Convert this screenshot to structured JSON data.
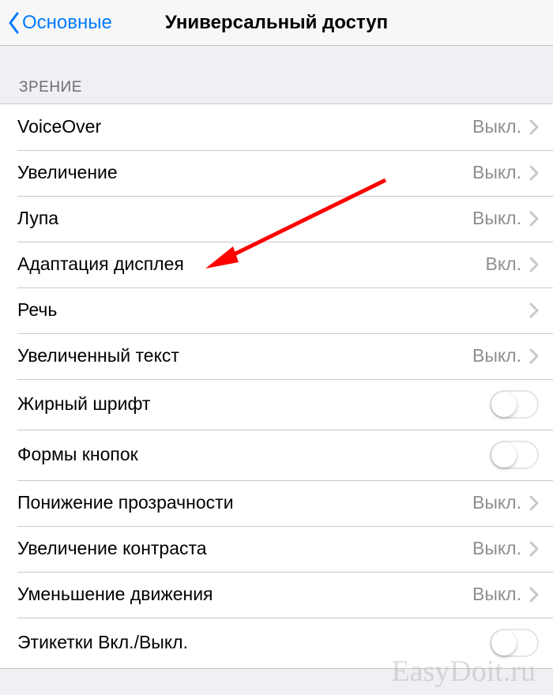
{
  "nav": {
    "back_label": "Основные",
    "title": "Универсальный доступ"
  },
  "section": {
    "header": "ЗРЕНИЕ"
  },
  "items": [
    {
      "label": "VoiceOver",
      "value": "Выкл.",
      "kind": "disclosure"
    },
    {
      "label": "Увеличение",
      "value": "Выкл.",
      "kind": "disclosure"
    },
    {
      "label": "Лупа",
      "value": "Выкл.",
      "kind": "disclosure"
    },
    {
      "label": "Адаптация дисплея",
      "value": "Вкл.",
      "kind": "disclosure"
    },
    {
      "label": "Речь",
      "value": "",
      "kind": "disclosure"
    },
    {
      "label": "Увеличенный текст",
      "value": "Выкл.",
      "kind": "disclosure"
    },
    {
      "label": "Жирный шрифт",
      "value": "",
      "kind": "toggle",
      "on": false
    },
    {
      "label": "Формы кнопок",
      "value": "",
      "kind": "toggle",
      "on": false
    },
    {
      "label": "Понижение прозрачности",
      "value": "Выкл.",
      "kind": "disclosure"
    },
    {
      "label": "Увеличение контраста",
      "value": "Выкл.",
      "kind": "disclosure"
    },
    {
      "label": "Уменьшение движения",
      "value": "Выкл.",
      "kind": "disclosure"
    },
    {
      "label": "Этикетки Вкл./Выкл.",
      "value": "",
      "kind": "toggle",
      "on": false
    }
  ],
  "watermark": "EasyDoit.ru"
}
